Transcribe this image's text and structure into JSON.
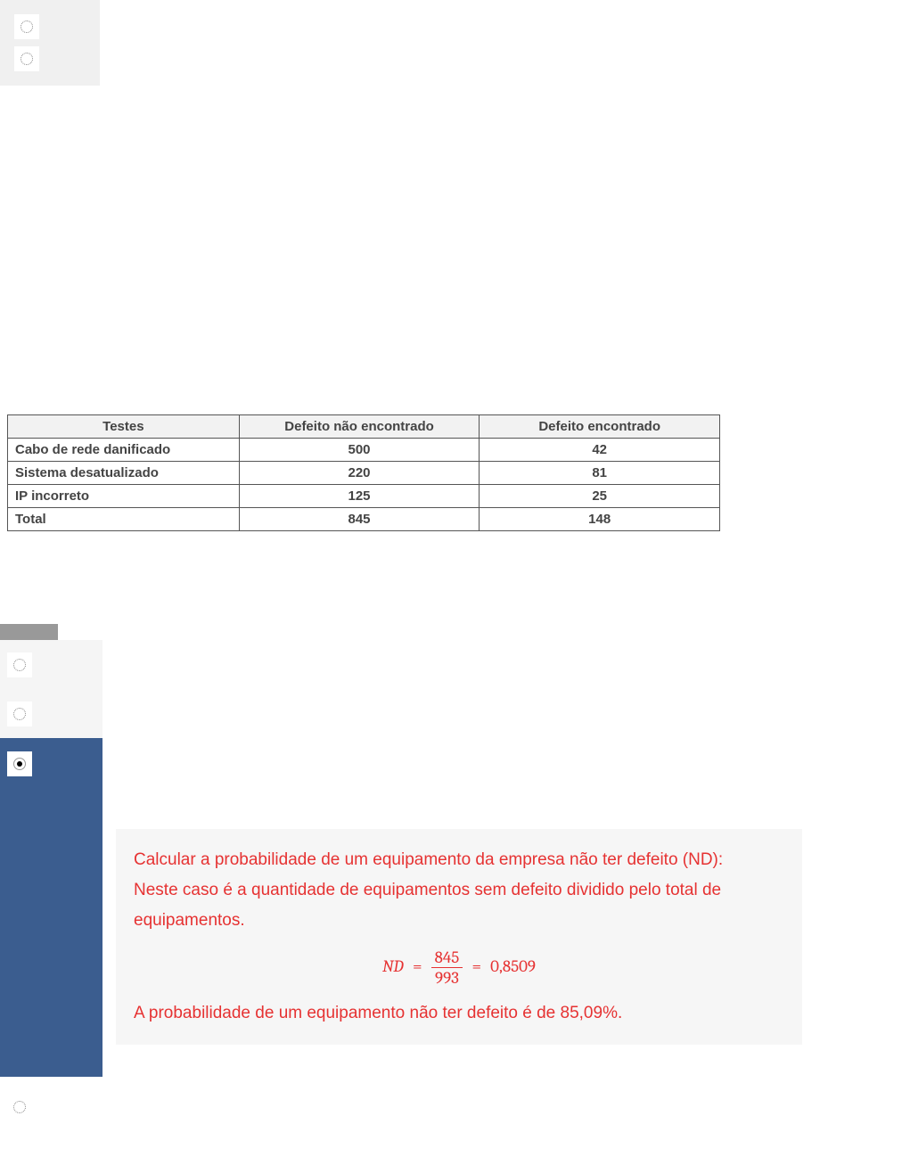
{
  "table": {
    "headers": [
      "Testes",
      "Defeito não encontrado",
      "Defeito encontrado"
    ],
    "rows": [
      [
        "Cabo de rede danificado",
        "500",
        "42"
      ],
      [
        "Sistema desatualizado",
        "220",
        "81"
      ],
      [
        "IP incorreto",
        "125",
        "25"
      ],
      [
        "Total",
        "845",
        "148"
      ]
    ]
  },
  "explanation": {
    "line1": "Calcular a probabilidade de um equipamento da empresa não ter defeito (ND):",
    "line2": "Neste caso é a quantidade de equipamentos sem defeito dividido pelo total de equipamentos.",
    "formula": {
      "lhs": "ND",
      "numerator": "845",
      "denominator": "993",
      "result": "0,8509"
    },
    "conclusion": "A probabilidade de um equipamento não ter defeito é de 85,09%."
  },
  "radios": {
    "top": [
      {
        "selected": false
      },
      {
        "selected": false
      }
    ],
    "bottom": [
      {
        "selected": false,
        "highlighted": false
      },
      {
        "selected": false,
        "highlighted": false
      },
      {
        "selected": true,
        "highlighted": true
      },
      {
        "selected": false,
        "highlighted": false
      }
    ]
  }
}
